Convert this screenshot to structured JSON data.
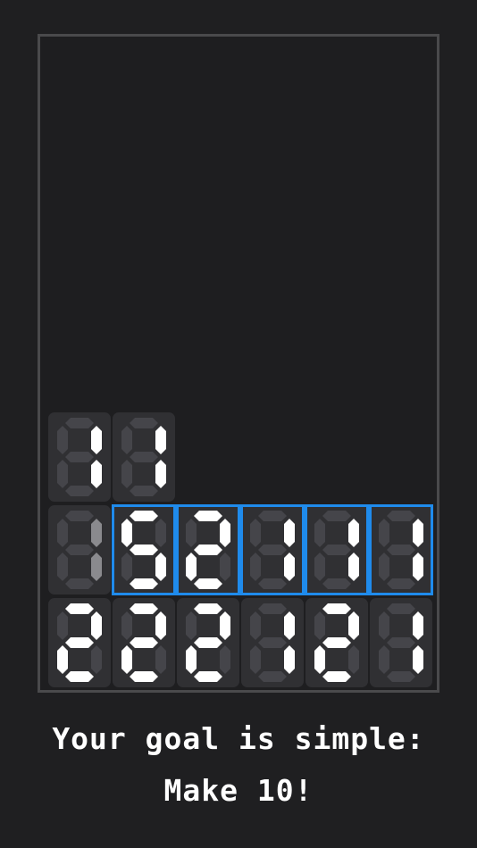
{
  "board": {
    "rows": [
      [
        {
          "digit": "1",
          "dim": false
        },
        {
          "digit": "1",
          "dim": false
        },
        null,
        null,
        null,
        null
      ],
      [
        {
          "digit": "1",
          "dim": true
        },
        {
          "digit": "5",
          "dim": false,
          "selected": true
        },
        {
          "digit": "2",
          "dim": false,
          "selected": true
        },
        {
          "digit": "1",
          "dim": false,
          "selected": true
        },
        {
          "digit": "1",
          "dim": false,
          "selected": true
        },
        {
          "digit": "1",
          "dim": false,
          "selected": true
        }
      ],
      [
        {
          "digit": "2",
          "dim": false
        },
        {
          "digit": "2",
          "dim": false
        },
        {
          "digit": "2",
          "dim": false
        },
        {
          "digit": "1",
          "dim": false
        },
        {
          "digit": "2",
          "dim": false
        },
        {
          "digit": "1",
          "dim": false
        }
      ]
    ]
  },
  "colors": {
    "background": "#1f1f21",
    "tile": "#303033",
    "segment_on": "#ffffff",
    "segment_off": "#45454a",
    "segment_dim": "#8a8a8e",
    "selection": "#1f8bec",
    "board_border": "#4a4a4c"
  },
  "message": {
    "line1": "Your goal is simple:",
    "line2": "Make 10!"
  }
}
